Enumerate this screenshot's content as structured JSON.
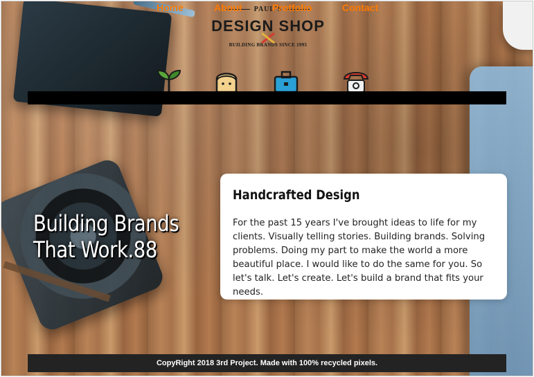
{
  "logo": {
    "top_text": "PAUL'S",
    "main_text": "DESIGN SHOP",
    "tagline": "BUILDING BRANDS SINCE 1995"
  },
  "nav": {
    "items": [
      {
        "label": "Home",
        "icon": "plant-icon"
      },
      {
        "label": "About",
        "icon": "person-icon"
      },
      {
        "label": "Protfolio",
        "icon": "briefcase-icon"
      },
      {
        "label": "Contact",
        "icon": "telephone-icon"
      }
    ],
    "accent_color": "#ff7a00",
    "bar_color": "#000000"
  },
  "hero": {
    "line1": "Building Brands",
    "line2": "That Work.88"
  },
  "card": {
    "title": "Handcrafted Design",
    "text": "For the past 15 years I've brought ideas to life for my clients. Visually telling stories. Building brands. Solving problems. Doing my part to make the world a more beautiful place. I would like to do the same for you. So let's talk. Let's create. Let's build a brand that fits your needs."
  },
  "footer": {
    "text": "CopyRight 2018 3rd Project. Made with 100% recycled pixels."
  }
}
